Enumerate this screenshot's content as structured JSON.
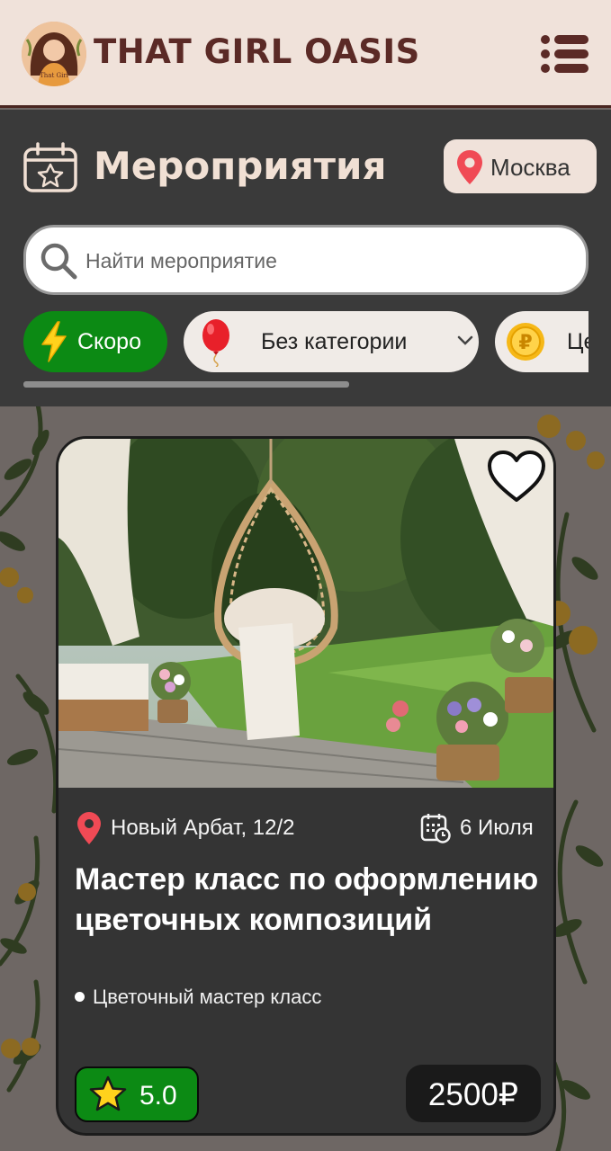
{
  "header": {
    "brand": "THAT GIRL OASIS",
    "logo_text": "That Girl Oasis",
    "menu_icon": "list-menu-icon"
  },
  "events": {
    "title": "Мероприятия",
    "title_icon": "calendar-star-icon",
    "city": "Москва",
    "city_icon": "map-pin-icon"
  },
  "search": {
    "placeholder": "Найти мероприятие",
    "value": "",
    "icon": "search-icon"
  },
  "filters": [
    {
      "label": "Скоро",
      "icon": "lightning-icon",
      "active": true
    },
    {
      "label": "Без категории",
      "icon": "balloon-icon",
      "dropdown": true
    },
    {
      "label": "Це",
      "icon": "ruble-coin-icon"
    }
  ],
  "card": {
    "location": "Новый Арбат, 12/2",
    "date": "6 Июля",
    "title": "Мастер класс по оформлению цветочных композиций",
    "category": "Цветочный мастер класс",
    "rating": "5.0",
    "price": "2500₽",
    "favorite": false
  },
  "colors": {
    "header_bg": "#f0e2da",
    "brand": "#5b2a26",
    "panel_bg": "#3a3a3a",
    "accent_green": "#0c8a14",
    "card_bg": "#343434"
  }
}
